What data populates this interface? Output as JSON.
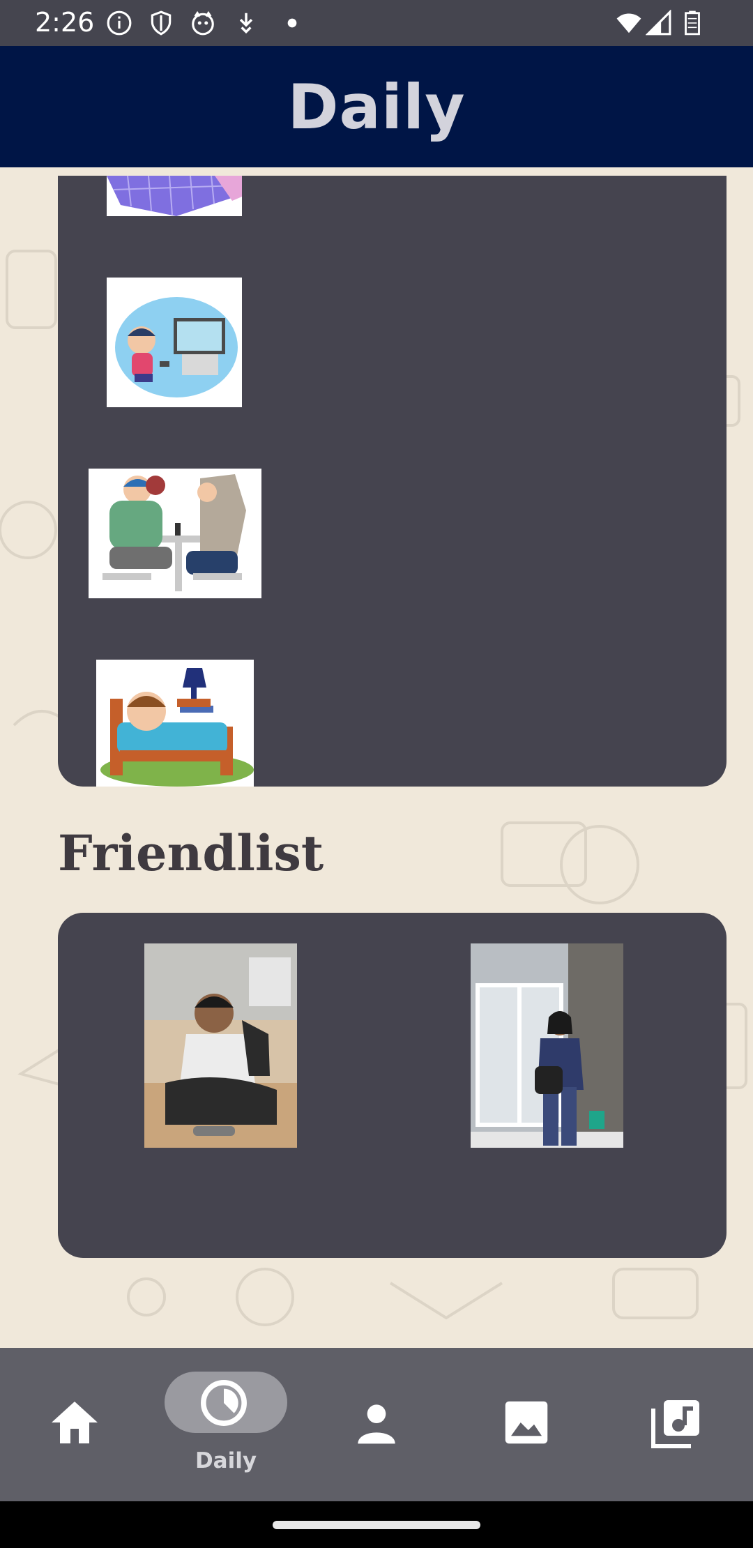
{
  "status_bar": {
    "time": "2:26",
    "left_icons": [
      "info-icon",
      "shield-icon",
      "cat-face-icon",
      "download-arrow-icon",
      "dot-icon"
    ],
    "right_icons": [
      "wifi-icon",
      "signal-icon",
      "battery-icon"
    ]
  },
  "app_bar": {
    "title": "Daily"
  },
  "activities": {
    "images": [
      {
        "name": "purple-box-image"
      },
      {
        "name": "kid-playing-video-game-image"
      },
      {
        "name": "friends-at-table-image"
      },
      {
        "name": "kid-sleeping-in-bed-image"
      }
    ]
  },
  "friendlist": {
    "title": "Friendlist",
    "photos": [
      {
        "name": "friend-photo-sitting"
      },
      {
        "name": "friend-photo-standing"
      }
    ]
  },
  "bottom_nav": {
    "items": [
      {
        "icon": "home-icon",
        "label": ""
      },
      {
        "icon": "clock-icon",
        "label": "Daily",
        "selected": true
      },
      {
        "icon": "person-icon",
        "label": ""
      },
      {
        "icon": "image-icon",
        "label": ""
      },
      {
        "icon": "music-library-icon",
        "label": ""
      }
    ]
  },
  "colors": {
    "status_bar": "#45454f",
    "app_bar": "#001546",
    "panel": "#45444f",
    "background": "#f0e8da",
    "bottom_nav": "#5f5f67"
  }
}
